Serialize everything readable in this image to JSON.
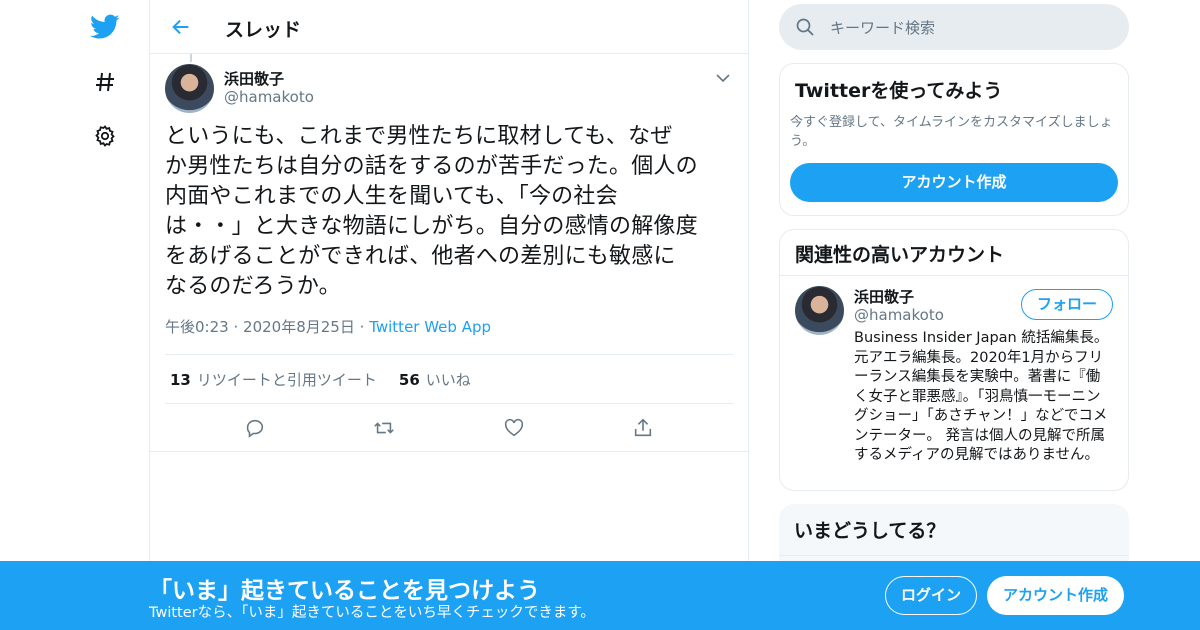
{
  "colors": {
    "accent": "#1da1f2",
    "text": "#14171a",
    "secondary": "#657786",
    "border": "#e6ecf0"
  },
  "nav": {
    "icons": [
      "twitter-bird-icon",
      "hashtag-icon",
      "gear-icon"
    ]
  },
  "header": {
    "title": "スレッド"
  },
  "tweet": {
    "author_name": "浜田敬子",
    "author_handle": "@hamakoto",
    "text_lines": [
      "というにも、これまで男性たちに取材しても、なぜ",
      "か男性たちは自分の話をするのが苦手だった。個人の",
      "内面やこれまでの人生を聞いても、「今の社会",
      "は・・」と大きな物語にしがち。自分の感情の解像度",
      "をあげることができれば、他者への差別にも敏感に",
      "なるのだろうか。"
    ],
    "time": "午後0:23",
    "date": "2020年8月25日",
    "sep": "·",
    "source": "Twitter Web App",
    "retweets_count": "13",
    "retweets_label": "リツイートと引用ツイート",
    "likes_count": "56",
    "likes_label": "いいね"
  },
  "search": {
    "placeholder": "キーワード検索"
  },
  "try_card": {
    "title": "Twitterを使ってみよう",
    "subtitle": "今すぐ登録して、タイムラインをカスタマイズしましょう。",
    "button": "アカウント作成"
  },
  "related": {
    "title": "関連性の高いアカウント",
    "name": "浜田敬子",
    "handle": "@hamakoto",
    "follow": "フォロー",
    "bio": "Business Insider Japan 統括編集長。元アエラ編集長。2020年1月からフリーランス編集長を実験中。著書に『働く女子と罪悪感』。「羽鳥慎一モーニングショー」「あさチャン！」などでコメンテーター。 発言は個人の見解で所属するメディアの見解ではありません。"
  },
  "trends": {
    "title": "いまどうしてる？"
  },
  "banner": {
    "headline": "「いま」起きていることを見つけよう",
    "subline": "Twitterなら、「いま」起きていることをいち早くチェックできます。",
    "login": "ログイン",
    "signup": "アカウント作成"
  }
}
